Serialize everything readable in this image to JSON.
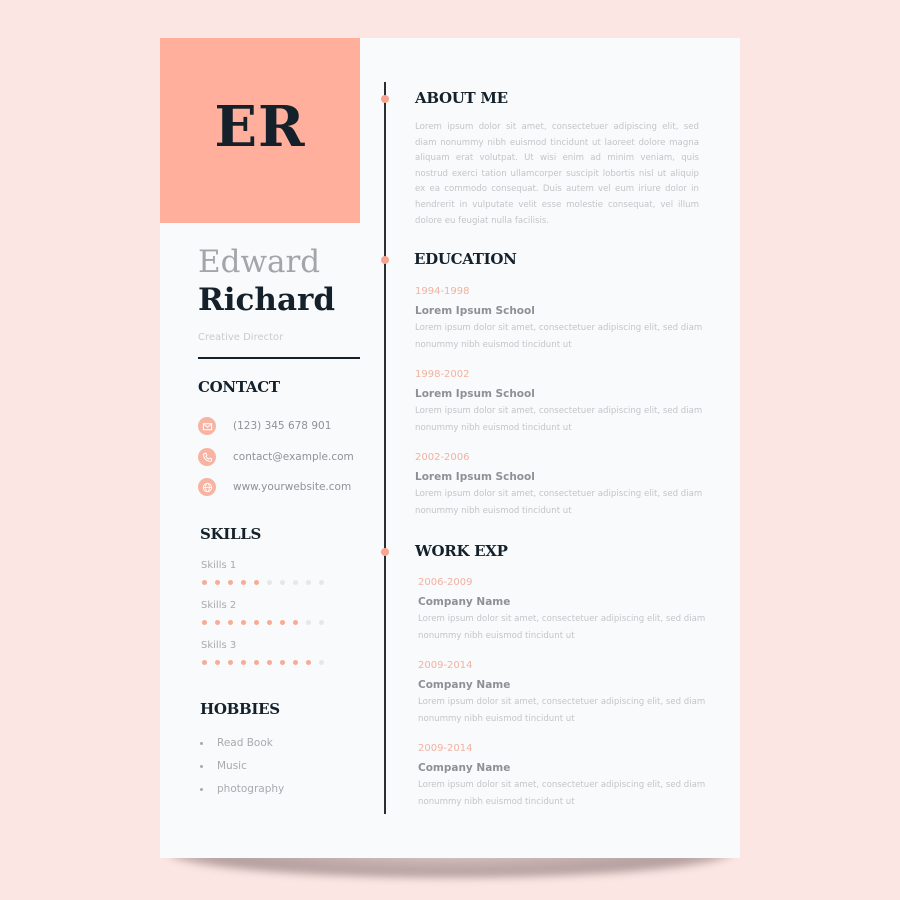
{
  "colors": {
    "accent": "#ffaf9c",
    "dark": "#14212b",
    "background": "#fbe6e3",
    "paper": "#f8fafc"
  },
  "header": {
    "monogram": "ER",
    "first_name": "Edward",
    "last_name": "Richard",
    "role": "Creative Director"
  },
  "contact": {
    "title": "CONTACT",
    "items": [
      {
        "icon": "mail-icon",
        "text": "(123) 345 678 901"
      },
      {
        "icon": "phone-icon",
        "text": "contact@example.com"
      },
      {
        "icon": "globe-icon",
        "text": "www.yourwebsite.com"
      }
    ]
  },
  "skills": {
    "title": "SKILLS",
    "items": [
      {
        "label": "Skills 1",
        "level": 5,
        "max": 10
      },
      {
        "label": "Skills 2",
        "level": 8,
        "max": 10
      },
      {
        "label": "Skills 3",
        "level": 9,
        "max": 10
      }
    ]
  },
  "hobbies": {
    "title": "HOBBIES",
    "items": [
      "Read Book",
      "Music",
      "photography"
    ]
  },
  "about": {
    "title": "ABOUT ME",
    "text": "Lorem ipsum dolor sit amet, consectetuer adipiscing elit, sed diam nonummy nibh euismod tincidunt ut laoreet dolore magna aliquam erat volutpat. Ut wisi enim ad minim veniam, quis nostrud exerci tation ullamcorper suscipit lobortis nisl ut aliquip ex ea commodo consequat. Duis autem vel eum iriure dolor in hendrerit in vulputate velit esse molestie consequat, vel illum dolore eu feugiat nulla facilisis."
  },
  "education": {
    "title": "EDUCATION",
    "items": [
      {
        "years": "1994-1998",
        "name": "Lorem Ipsum School",
        "desc": "Lorem ipsum dolor sit amet, consectetuer adipiscing elit, sed diam nonummy nibh euismod tincidunt ut"
      },
      {
        "years": "1998-2002",
        "name": "Lorem Ipsum School",
        "desc": "Lorem ipsum dolor sit amet, consectetuer adipiscing elit, sed diam nonummy nibh euismod tincidunt ut"
      },
      {
        "years": "2002-2006",
        "name": "Lorem Ipsum School",
        "desc": "Lorem ipsum dolor sit amet, consectetuer adipiscing elit, sed diam nonummy nibh euismod tincidunt ut"
      }
    ]
  },
  "work": {
    "title": "WORK EXP",
    "items": [
      {
        "years": "2006-2009",
        "name": "Company Name",
        "desc": "Lorem ipsum dolor sit amet, consectetuer adipiscing elit, sed diam nonummy nibh euismod tincidunt ut"
      },
      {
        "years": "2009-2014",
        "name": "Company Name",
        "desc": "Lorem ipsum dolor sit amet, consectetuer adipiscing elit, sed diam nonummy nibh euismod tincidunt ut"
      },
      {
        "years": "2009-2014",
        "name": "Company Name",
        "desc": "Lorem ipsum dolor sit amet, consectetuer adipiscing elit, sed diam nonummy nibh euismod tincidunt ut"
      }
    ]
  }
}
